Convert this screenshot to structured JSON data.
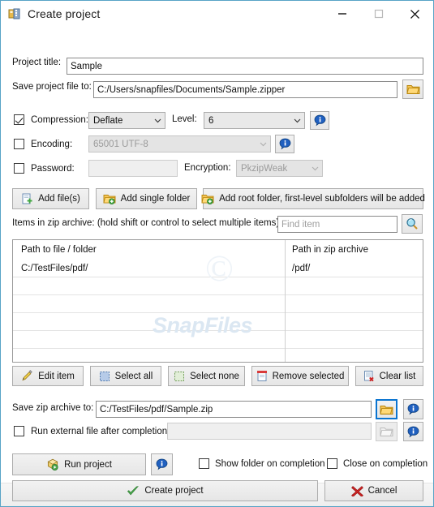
{
  "window": {
    "title": "Create project",
    "icon": "zip-project-icon",
    "controls": {
      "minimize": "minimize-icon",
      "maximize": "maximize-icon",
      "close": "close-icon"
    }
  },
  "form": {
    "project_title_label": "Project title:",
    "project_title_value": "Sample",
    "save_project_label": "Save project file to:",
    "save_project_value": "C:/Users/snapfiles/Documents/Sample.zipper",
    "browse_icon": "folder-icon"
  },
  "compression": {
    "checkbox_label": "Compression:",
    "checked": true,
    "method": "Deflate",
    "level_label": "Level:",
    "level": "6",
    "info_icon": "info-icon"
  },
  "encoding": {
    "checkbox_label": "Encoding:",
    "checked": false,
    "value": "65001 UTF-8",
    "info_icon": "info-icon"
  },
  "password": {
    "checkbox_label": "Password:",
    "checked": false,
    "value": "",
    "encryption_label": "Encryption:",
    "encryption_value": "PkzipWeak"
  },
  "add_buttons": [
    {
      "label": "Add file(s)",
      "icon": "add-file-icon"
    },
    {
      "label": "Add single folder",
      "icon": "add-folder-icon"
    },
    {
      "label": "Add root folder, first-level subfolders will be added",
      "icon": "add-root-folder-icon"
    }
  ],
  "items_section": {
    "label": "Items in zip archive: (hold shift or control to select multiple items)",
    "find_placeholder": "Find item",
    "find_value": "",
    "search_icon": "magnifier-icon"
  },
  "list": {
    "columns": [
      "Path to file / folder",
      "Path in zip archive"
    ],
    "rows": [
      {
        "path": "C:/TestFiles/pdf/",
        "zip_path": "/pdf/"
      }
    ],
    "empty_rows": 5
  },
  "watermark": {
    "text": "SnapFiles",
    "mark": "©"
  },
  "list_buttons": [
    {
      "label": "Edit item",
      "icon": "pencil-icon"
    },
    {
      "label": "Select all",
      "icon": "select-all-icon"
    },
    {
      "label": "Select none",
      "icon": "select-none-icon"
    },
    {
      "label": "Remove selected",
      "icon": "remove-icon"
    },
    {
      "label": "Clear list",
      "icon": "clear-list-icon"
    }
  ],
  "output": {
    "save_zip_label": "Save zip archive to:",
    "save_zip_value": "C:/TestFiles/pdf/Sample.zip",
    "folder_icon": "folder-icon",
    "info_icon": "info-icon",
    "run_external_label": "Run external file after completion:",
    "run_external_checked": false,
    "run_external_value": ""
  },
  "footer": {
    "run_project_label": "Run project",
    "run_project_icon": "run-project-icon",
    "run_info_icon": "info-icon",
    "show_folder_label": "Show folder on completion",
    "show_folder_checked": false,
    "close_label": "Close on completion",
    "close_checked": false,
    "create_label": "Create project",
    "create_icon": "green-check-icon",
    "cancel_label": "Cancel",
    "cancel_icon": "red-x-icon"
  },
  "colors": {
    "window_border": "#58a3c6",
    "accent_focus": "#0a74d0",
    "info_blue": "#1f5fbf",
    "check_green": "#3ea43e",
    "cancel_red": "#cc2222"
  }
}
